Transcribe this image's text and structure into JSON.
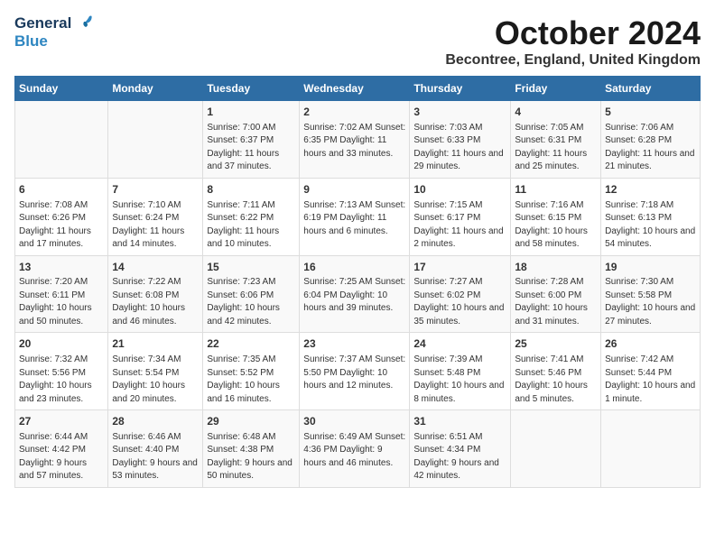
{
  "header": {
    "logo_general": "General",
    "logo_blue": "Blue",
    "month_title": "October 2024",
    "location": "Becontree, England, United Kingdom"
  },
  "days_of_week": [
    "Sunday",
    "Monday",
    "Tuesday",
    "Wednesday",
    "Thursday",
    "Friday",
    "Saturday"
  ],
  "weeks": [
    [
      {
        "day": "",
        "content": ""
      },
      {
        "day": "",
        "content": ""
      },
      {
        "day": "1",
        "content": "Sunrise: 7:00 AM\nSunset: 6:37 PM\nDaylight: 11 hours\nand 37 minutes."
      },
      {
        "day": "2",
        "content": "Sunrise: 7:02 AM\nSunset: 6:35 PM\nDaylight: 11 hours\nand 33 minutes."
      },
      {
        "day": "3",
        "content": "Sunrise: 7:03 AM\nSunset: 6:33 PM\nDaylight: 11 hours\nand 29 minutes."
      },
      {
        "day": "4",
        "content": "Sunrise: 7:05 AM\nSunset: 6:31 PM\nDaylight: 11 hours\nand 25 minutes."
      },
      {
        "day": "5",
        "content": "Sunrise: 7:06 AM\nSunset: 6:28 PM\nDaylight: 11 hours\nand 21 minutes."
      }
    ],
    [
      {
        "day": "6",
        "content": "Sunrise: 7:08 AM\nSunset: 6:26 PM\nDaylight: 11 hours\nand 17 minutes."
      },
      {
        "day": "7",
        "content": "Sunrise: 7:10 AM\nSunset: 6:24 PM\nDaylight: 11 hours\nand 14 minutes."
      },
      {
        "day": "8",
        "content": "Sunrise: 7:11 AM\nSunset: 6:22 PM\nDaylight: 11 hours\nand 10 minutes."
      },
      {
        "day": "9",
        "content": "Sunrise: 7:13 AM\nSunset: 6:19 PM\nDaylight: 11 hours\nand 6 minutes."
      },
      {
        "day": "10",
        "content": "Sunrise: 7:15 AM\nSunset: 6:17 PM\nDaylight: 11 hours\nand 2 minutes."
      },
      {
        "day": "11",
        "content": "Sunrise: 7:16 AM\nSunset: 6:15 PM\nDaylight: 10 hours\nand 58 minutes."
      },
      {
        "day": "12",
        "content": "Sunrise: 7:18 AM\nSunset: 6:13 PM\nDaylight: 10 hours\nand 54 minutes."
      }
    ],
    [
      {
        "day": "13",
        "content": "Sunrise: 7:20 AM\nSunset: 6:11 PM\nDaylight: 10 hours\nand 50 minutes."
      },
      {
        "day": "14",
        "content": "Sunrise: 7:22 AM\nSunset: 6:08 PM\nDaylight: 10 hours\nand 46 minutes."
      },
      {
        "day": "15",
        "content": "Sunrise: 7:23 AM\nSunset: 6:06 PM\nDaylight: 10 hours\nand 42 minutes."
      },
      {
        "day": "16",
        "content": "Sunrise: 7:25 AM\nSunset: 6:04 PM\nDaylight: 10 hours\nand 39 minutes."
      },
      {
        "day": "17",
        "content": "Sunrise: 7:27 AM\nSunset: 6:02 PM\nDaylight: 10 hours\nand 35 minutes."
      },
      {
        "day": "18",
        "content": "Sunrise: 7:28 AM\nSunset: 6:00 PM\nDaylight: 10 hours\nand 31 minutes."
      },
      {
        "day": "19",
        "content": "Sunrise: 7:30 AM\nSunset: 5:58 PM\nDaylight: 10 hours\nand 27 minutes."
      }
    ],
    [
      {
        "day": "20",
        "content": "Sunrise: 7:32 AM\nSunset: 5:56 PM\nDaylight: 10 hours\nand 23 minutes."
      },
      {
        "day": "21",
        "content": "Sunrise: 7:34 AM\nSunset: 5:54 PM\nDaylight: 10 hours\nand 20 minutes."
      },
      {
        "day": "22",
        "content": "Sunrise: 7:35 AM\nSunset: 5:52 PM\nDaylight: 10 hours\nand 16 minutes."
      },
      {
        "day": "23",
        "content": "Sunrise: 7:37 AM\nSunset: 5:50 PM\nDaylight: 10 hours\nand 12 minutes."
      },
      {
        "day": "24",
        "content": "Sunrise: 7:39 AM\nSunset: 5:48 PM\nDaylight: 10 hours\nand 8 minutes."
      },
      {
        "day": "25",
        "content": "Sunrise: 7:41 AM\nSunset: 5:46 PM\nDaylight: 10 hours\nand 5 minutes."
      },
      {
        "day": "26",
        "content": "Sunrise: 7:42 AM\nSunset: 5:44 PM\nDaylight: 10 hours\nand 1 minute."
      }
    ],
    [
      {
        "day": "27",
        "content": "Sunrise: 6:44 AM\nSunset: 4:42 PM\nDaylight: 9 hours\nand 57 minutes."
      },
      {
        "day": "28",
        "content": "Sunrise: 6:46 AM\nSunset: 4:40 PM\nDaylight: 9 hours\nand 53 minutes."
      },
      {
        "day": "29",
        "content": "Sunrise: 6:48 AM\nSunset: 4:38 PM\nDaylight: 9 hours\nand 50 minutes."
      },
      {
        "day": "30",
        "content": "Sunrise: 6:49 AM\nSunset: 4:36 PM\nDaylight: 9 hours\nand 46 minutes."
      },
      {
        "day": "31",
        "content": "Sunrise: 6:51 AM\nSunset: 4:34 PM\nDaylight: 9 hours\nand 42 minutes."
      },
      {
        "day": "",
        "content": ""
      },
      {
        "day": "",
        "content": ""
      }
    ]
  ]
}
